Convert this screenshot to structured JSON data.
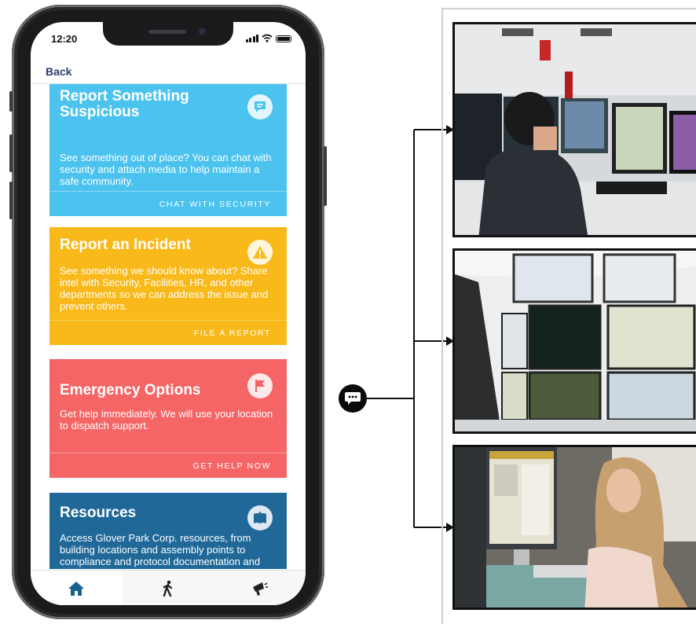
{
  "status_bar": {
    "time": "12:20"
  },
  "nav": {
    "back_label": "Back"
  },
  "cards": [
    {
      "title": "Report Something Suspicious",
      "description": "See something out of place? You can chat with security and attach media to help maintain a safe community.",
      "action": "CHAT WITH SECURITY",
      "icon": "chat-bubble-icon",
      "color": "#4cc3ef"
    },
    {
      "title": "Report an Incident",
      "description": "See something we should know about? Share intel with Security, Facilities, HR, and other departments so we can address the issue and prevent others.",
      "action": "FILE A REPORT",
      "icon": "warning-icon",
      "color": "#f9b91a"
    },
    {
      "title": "Emergency Options",
      "description": "Get help immediately. We will use your location to dispatch support.",
      "action": "GET HELP NOW",
      "icon": "flag-icon",
      "color": "#f56566"
    },
    {
      "title": "Resources",
      "description": "Access Glover Park Corp. resources, from building locations and assembly points to compliance and protocol documentation and training.",
      "icon": "book-icon",
      "color": "#1f6898"
    }
  ],
  "tabs": [
    {
      "icon": "home-icon",
      "active": true
    },
    {
      "icon": "walking-person-icon",
      "active": false
    },
    {
      "icon": "megaphone-icon",
      "active": false
    }
  ],
  "colors": {
    "accent": "#1b5f8e",
    "nav_text": "#2a3d72"
  },
  "diagram": {
    "source_icon": "chat-icon",
    "targets": [
      "security-operator-photo",
      "monitoring-wall-photo",
      "analyst-workstation-photo"
    ]
  }
}
